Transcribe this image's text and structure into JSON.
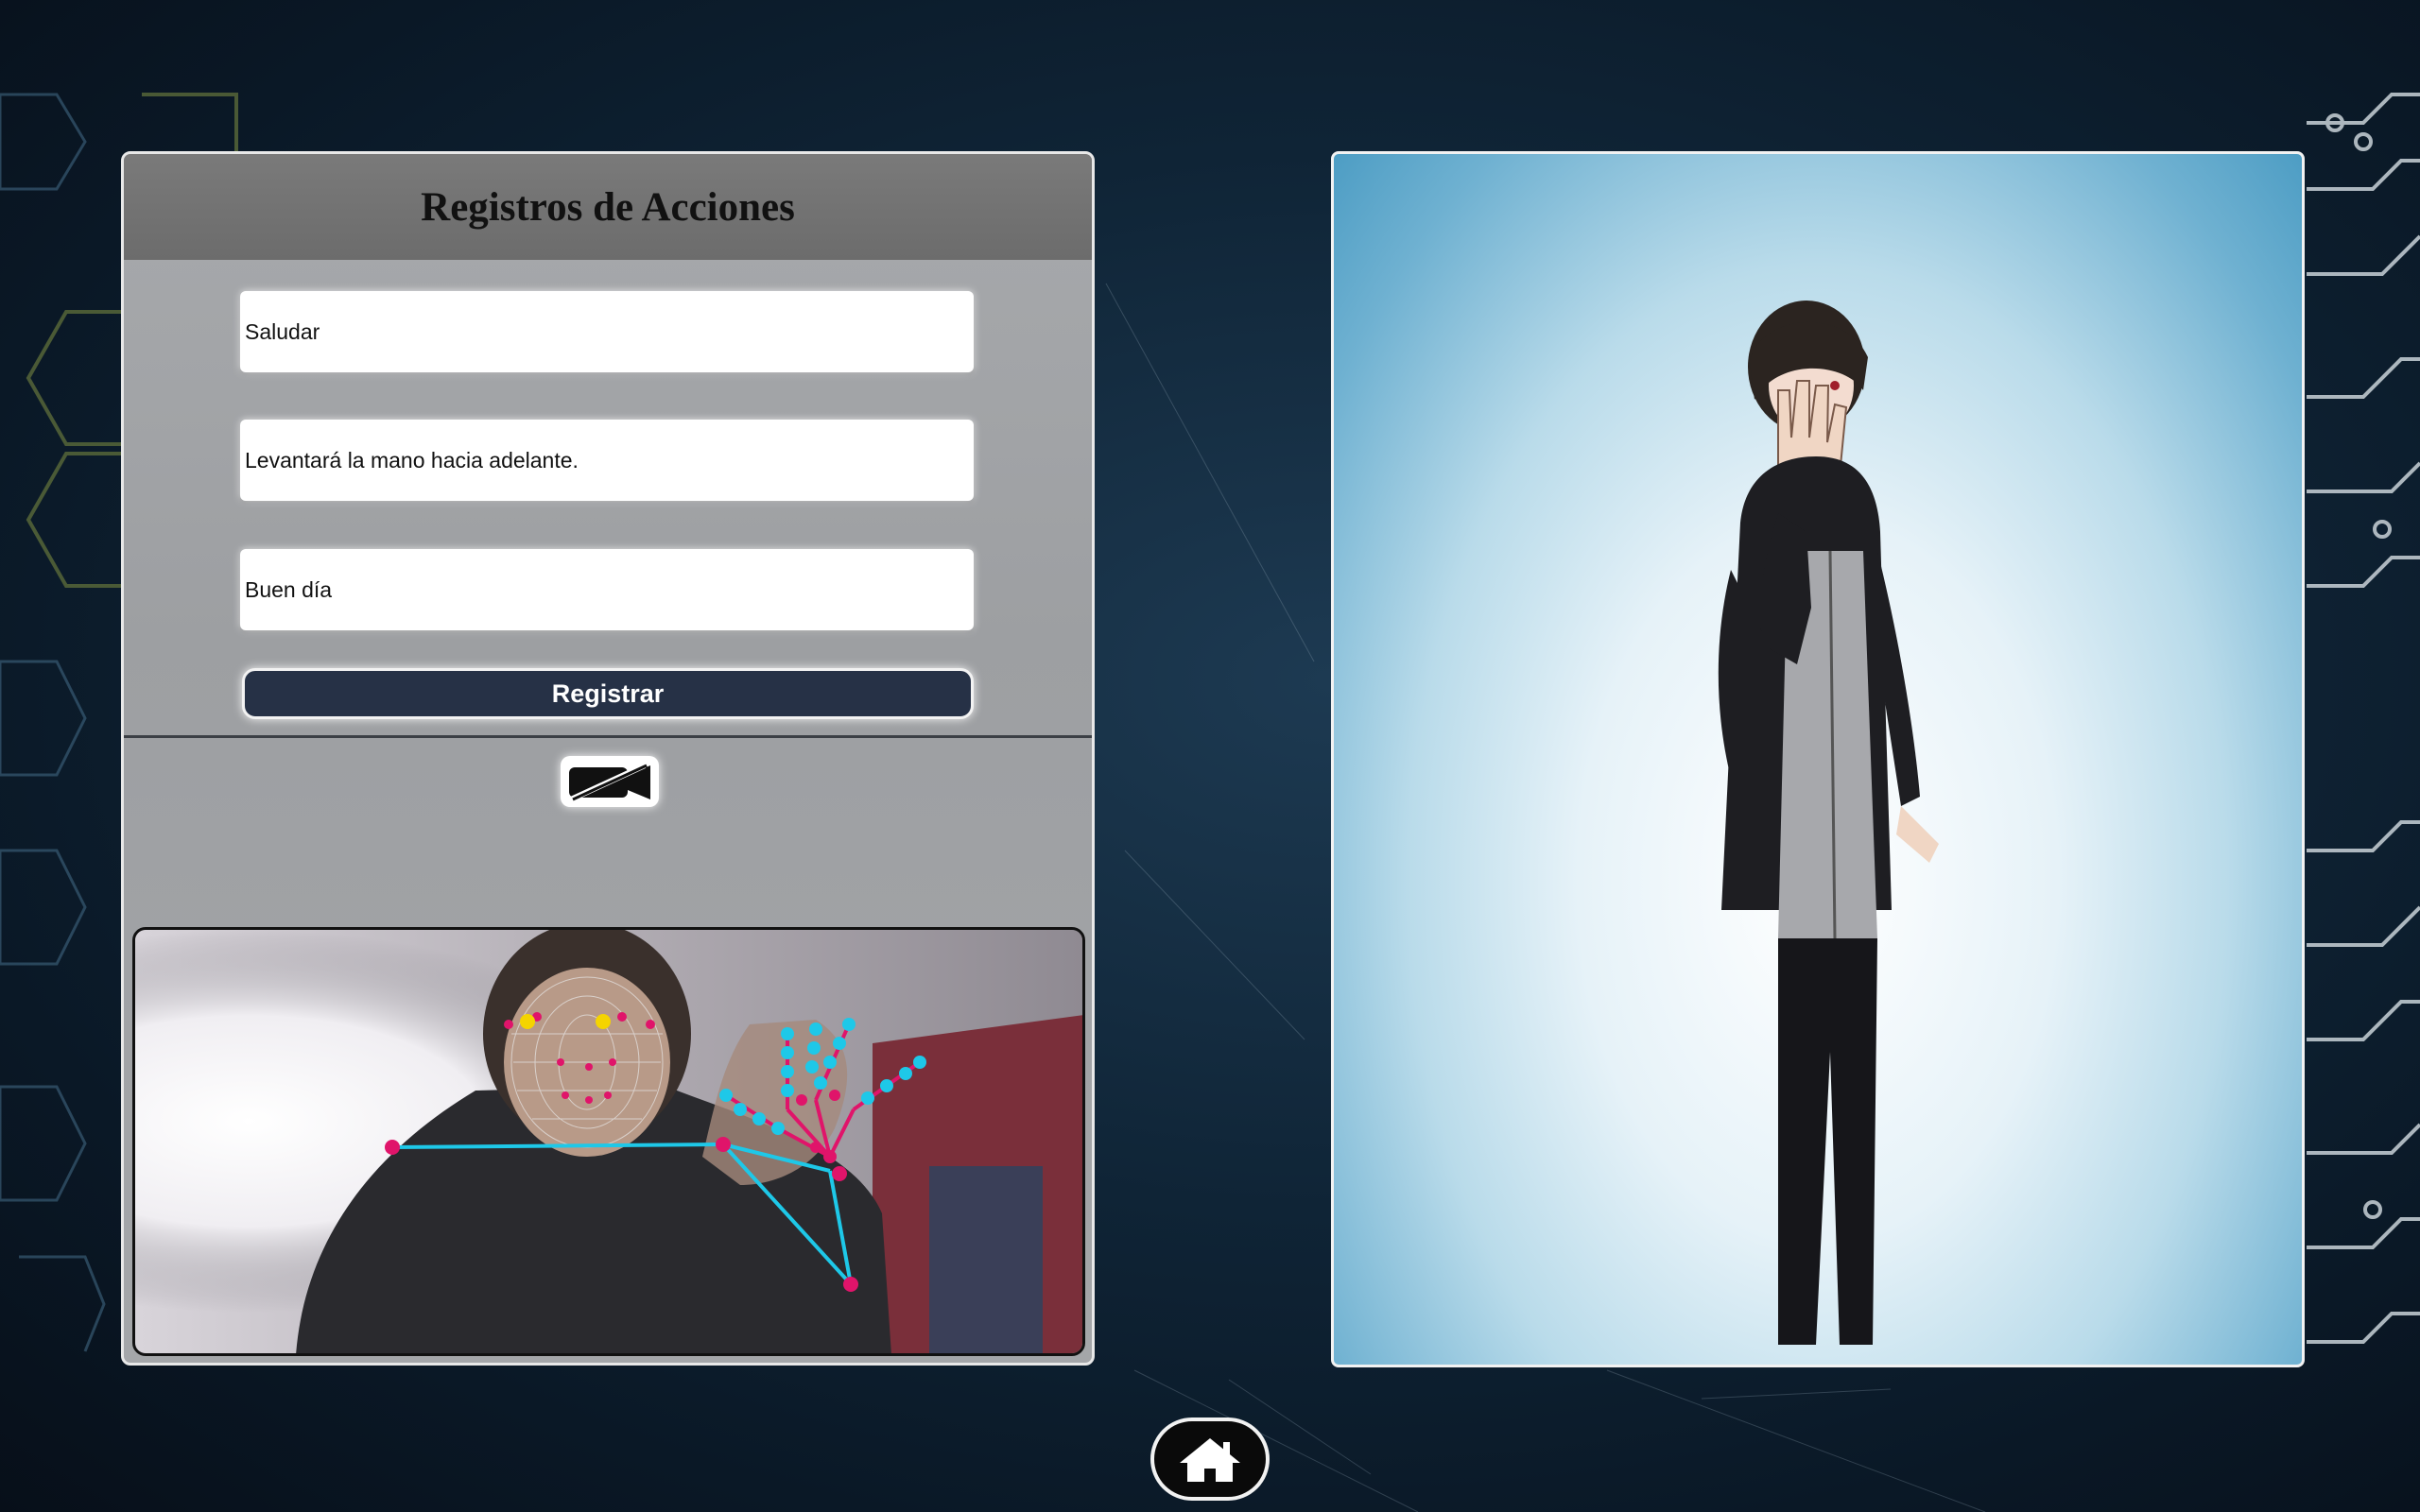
{
  "panel": {
    "title": "Registros de Acciones",
    "fields": {
      "action": "Saludar",
      "description": "Levantará la mano hacia adelante.",
      "phrase": "Buen día"
    },
    "register_label": "Registrar",
    "camera_toggle_icon": "camera-off-icon"
  },
  "avatar_view": {
    "icon": "avatar-3d-model"
  },
  "nav": {
    "home_icon": "home-icon"
  }
}
